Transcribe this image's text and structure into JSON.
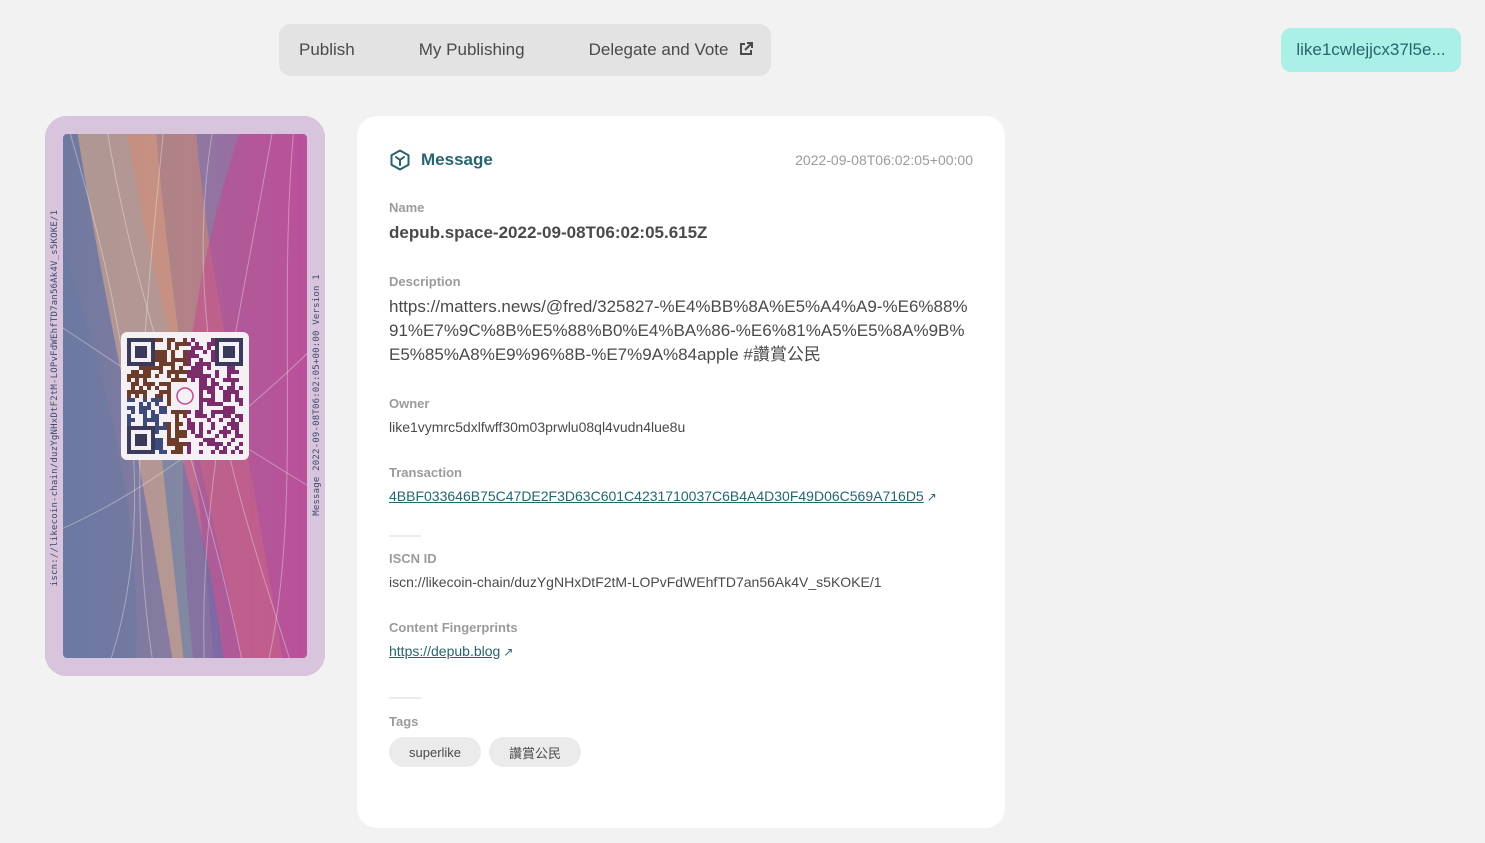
{
  "nav": {
    "publish": "Publish",
    "my_publishing": "My Publishing",
    "delegate": "Delegate and Vote"
  },
  "wallet": {
    "address": "like1cwlejjcx37l5e..."
  },
  "nft": {
    "left_text": "iscn://likecoin-chain/duzYgNHxDtF2tM-LOPvFdWEhfTD7an56Ak4V_s5KOKE/1",
    "right_text": "Message 2022-09-08T06:02:05+00:00 Version 1"
  },
  "panel": {
    "type": "Message",
    "timestamp": "2022-09-08T06:02:05+00:00",
    "name_label": "Name",
    "name": "depub.space-2022-09-08T06:02:05.615Z",
    "description_label": "Description",
    "description": "https://matters.news/@fred/325827-%E4%BB%8A%E5%A4%A9-%E6%88%91%E7%9C%8B%E5%88%B0%E4%BA%86-%E6%81%A5%E5%8A%9B%E5%85%A8%E9%96%8B-%E7%9A%84apple #讚賞公民",
    "owner_label": "Owner",
    "owner": "like1vymrc5dxlfwff30m03prwlu08ql4vudn4lue8u",
    "transaction_label": "Transaction",
    "transaction": "4BBF033646B75C47DE2F3D63C601C4231710037C6B4A4D30F49D06C569A716D5",
    "iscn_label": "ISCN ID",
    "iscn": "iscn://likecoin-chain/duzYgNHxDtF2tM-LOPvFdWEhfTD7an56Ak4V_s5KOKE/1",
    "fingerprints_label": "Content Fingerprints",
    "fingerprint": "https://depub.blog",
    "tags_label": "Tags",
    "tags": [
      "superlike",
      "讚賞公民"
    ]
  },
  "colors": {
    "accent": "#28646e",
    "wallet_bg": "#aaf0e6"
  }
}
